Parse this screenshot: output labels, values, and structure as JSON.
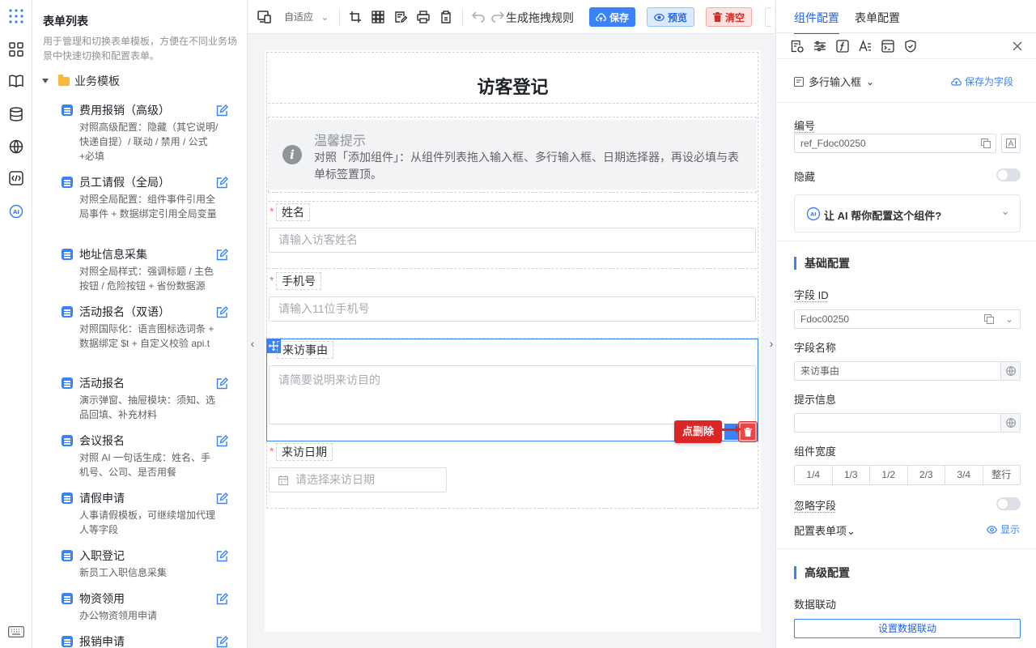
{
  "sidebar_list": {
    "title": "表单列表",
    "description": "用于管理和切换表单模板，方便在不同业务场景中快速切换和配置表单。",
    "folder": "业务模板",
    "items": [
      {
        "name": "费用报销（高级）",
        "desc": "对照高级配置：隐藏（其它说明/快递自提）/ 联动 / 禁用 / 公式+必填"
      },
      {
        "name": "员工请假（全局）",
        "desc": "对照全局配置：组件事件引用全局事件 + 数据绑定引用全局变量"
      },
      {
        "name": "地址信息采集",
        "desc": "对照全局样式：强调标题 / 主色按钮 / 危险按钮 + 省份数据源"
      },
      {
        "name": "活动报名（双语）",
        "desc": "对照国际化：语言图标选词条 + 数据绑定 $t + 自定义校验 api.t"
      },
      {
        "name": "活动报名",
        "desc": "演示弹窗、抽屉模块：须知、选品回填、补充材料"
      },
      {
        "name": "会议报名",
        "desc": "对照 AI 一句话生成：姓名、手机号、公司、是否用餐"
      },
      {
        "name": "请假申请",
        "desc": "人事请假模板，可继续增加代理人等字段"
      },
      {
        "name": "入职登记",
        "desc": "新员工入职信息采集"
      },
      {
        "name": "物资领用",
        "desc": "办公物资领用申请"
      },
      {
        "name": "报销申请",
        "desc": ""
      }
    ]
  },
  "toolbar": {
    "layout_select": "自适应",
    "generate_rule": "生成拖拽规则",
    "save": "保存",
    "preview": "预览",
    "clear": "清空"
  },
  "form": {
    "title": "访客登记",
    "tip_title": "温馨提示",
    "tip_text": "对照「添加组件」：从组件列表拖入输入框、多行输入框、日期选择器，再设必填与表单标签置顶。",
    "fields": [
      {
        "label": "姓名",
        "placeholder": "请输入访客姓名",
        "required": true
      },
      {
        "label": "手机号",
        "placeholder": "请输入11位手机号",
        "required": true
      },
      {
        "label": "来访事由",
        "placeholder": "请简要说明来访目的",
        "required": false
      },
      {
        "label": "来访日期",
        "placeholder": "请选择来访日期",
        "required": true
      }
    ],
    "delete_callout": "点删除"
  },
  "right_panel": {
    "tabs": [
      "组件配置",
      "表单配置"
    ],
    "component_type": "多行输入框",
    "save_as_field": "保存为字段",
    "id_label": "编号",
    "id_value": "ref_Fdoc00250",
    "hidden_label": "隐藏",
    "ai_prompt": "让 AI 帮你配置这个组件?",
    "basic_section": "基础配置",
    "field_id_label": "字段 ID",
    "field_id_value": "Fdoc00250",
    "field_name_label": "字段名称",
    "field_name_value": "来访事由",
    "hint_label": "提示信息",
    "hint_value": "",
    "width_label": "组件宽度",
    "width_options": [
      "1/4",
      "1/3",
      "1/2",
      "2/3",
      "3/4",
      "整行"
    ],
    "ignore_label": "忽略字段",
    "config_items_label": "配置表单项",
    "show_label": "显示",
    "advanced_section": "高级配置",
    "linkage_label": "数据联动",
    "linkage_button": "设置数据联动"
  }
}
